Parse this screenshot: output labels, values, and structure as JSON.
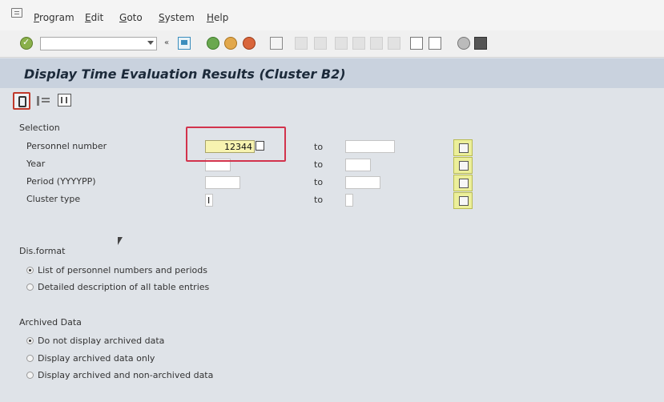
{
  "menu": {
    "items": [
      "Program",
      "Edit",
      "Goto",
      "System",
      "Help"
    ]
  },
  "toolbar": {
    "command_value": "",
    "small_label": "«"
  },
  "page": {
    "title": "Display Time Evaluation Results (Cluster B2)"
  },
  "selection": {
    "title": "Selection",
    "rows": [
      {
        "label": "Personnel number",
        "from": "12344",
        "to": ""
      },
      {
        "label": "Year",
        "from": "",
        "to": ""
      },
      {
        "label": "Period (YYYYPP)",
        "from": "",
        "to": ""
      },
      {
        "label": "Cluster type",
        "from": "I",
        "to": ""
      }
    ],
    "to_label": "to"
  },
  "output": {
    "title": "Dis.format",
    "options": [
      {
        "label": "List of personnel numbers and periods",
        "selected": true
      },
      {
        "label": "Detailed description of all table entries",
        "selected": false
      }
    ]
  },
  "archived": {
    "title": "Archived Data",
    "options": [
      {
        "label": "Do not display archived data",
        "selected": true
      },
      {
        "label": "Display archived data only",
        "selected": false
      },
      {
        "label": "Display archived and non-archived data",
        "selected": false
      }
    ]
  },
  "icons": {
    "app": "menu-icon",
    "execute": "execute-icon",
    "variant": "get-variant-icon",
    "info": "program-info-icon",
    "f4": "value-help-icon",
    "multi": "multiple-selection-icon"
  },
  "colors": {
    "title_bar": "#c9d2de",
    "required_field": "#f7f3b0",
    "highlight": "#d2334c"
  }
}
